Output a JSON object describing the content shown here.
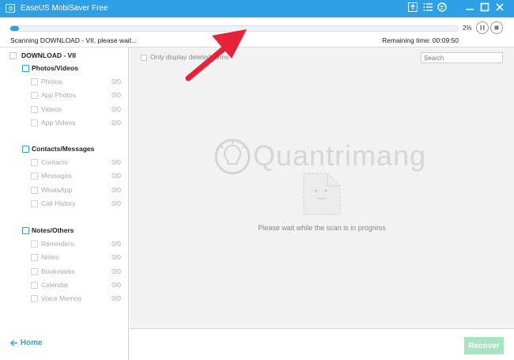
{
  "window": {
    "title": "EaseUS MobiSaver Free",
    "controls": [
      "upload-icon",
      "menu-icon",
      "globe-icon",
      "minimize-icon",
      "maximize-icon",
      "close-icon"
    ]
  },
  "scan": {
    "progress_percent": 2,
    "percent_label": "2%",
    "status": "Scanning DOWNLOAD - VII, please wait...",
    "remaining": "Remaining time: 00:09:50"
  },
  "sidebar": {
    "root_label": "DOWNLOAD - VII",
    "groups": [
      {
        "label": "Photos/Videos",
        "icon": "image-icon",
        "items": [
          {
            "label": "Photos",
            "count": "0/0"
          },
          {
            "label": "App Photos",
            "count": "0/0"
          },
          {
            "label": "Videos",
            "count": "0/0"
          },
          {
            "label": "App Videos",
            "count": "0/0"
          }
        ]
      },
      {
        "label": "Contacts/Messages",
        "icon": "contact-card-icon",
        "items": [
          {
            "label": "Contacts",
            "count": "0/0"
          },
          {
            "label": "Messages",
            "count": "0/0"
          },
          {
            "label": "WhatsApp",
            "count": "0/0"
          },
          {
            "label": "Call History",
            "count": "0/0"
          }
        ]
      },
      {
        "label": "Notes/Others",
        "icon": "notes-icon",
        "items": [
          {
            "label": "Reminders",
            "count": "0/0"
          },
          {
            "label": "Notes",
            "count": "0/0"
          },
          {
            "label": "Bookmarks",
            "count": "0/0"
          },
          {
            "label": "Calendar",
            "count": "0/0"
          },
          {
            "label": "Voice Memos",
            "count": "0/0"
          }
        ]
      }
    ],
    "home_label": "Home"
  },
  "main": {
    "only_deleted_label": "Only display deleted items",
    "search_placeholder": "Search",
    "wait_message": "Please wait while the scan is in progress",
    "watermark_text": "Quantrimang"
  },
  "footer": {
    "recover_label": "Recover"
  },
  "colors": {
    "accent": "#2f9fe6",
    "recover_disabled": "#a9e3c1",
    "arrow": "#e8213a"
  }
}
